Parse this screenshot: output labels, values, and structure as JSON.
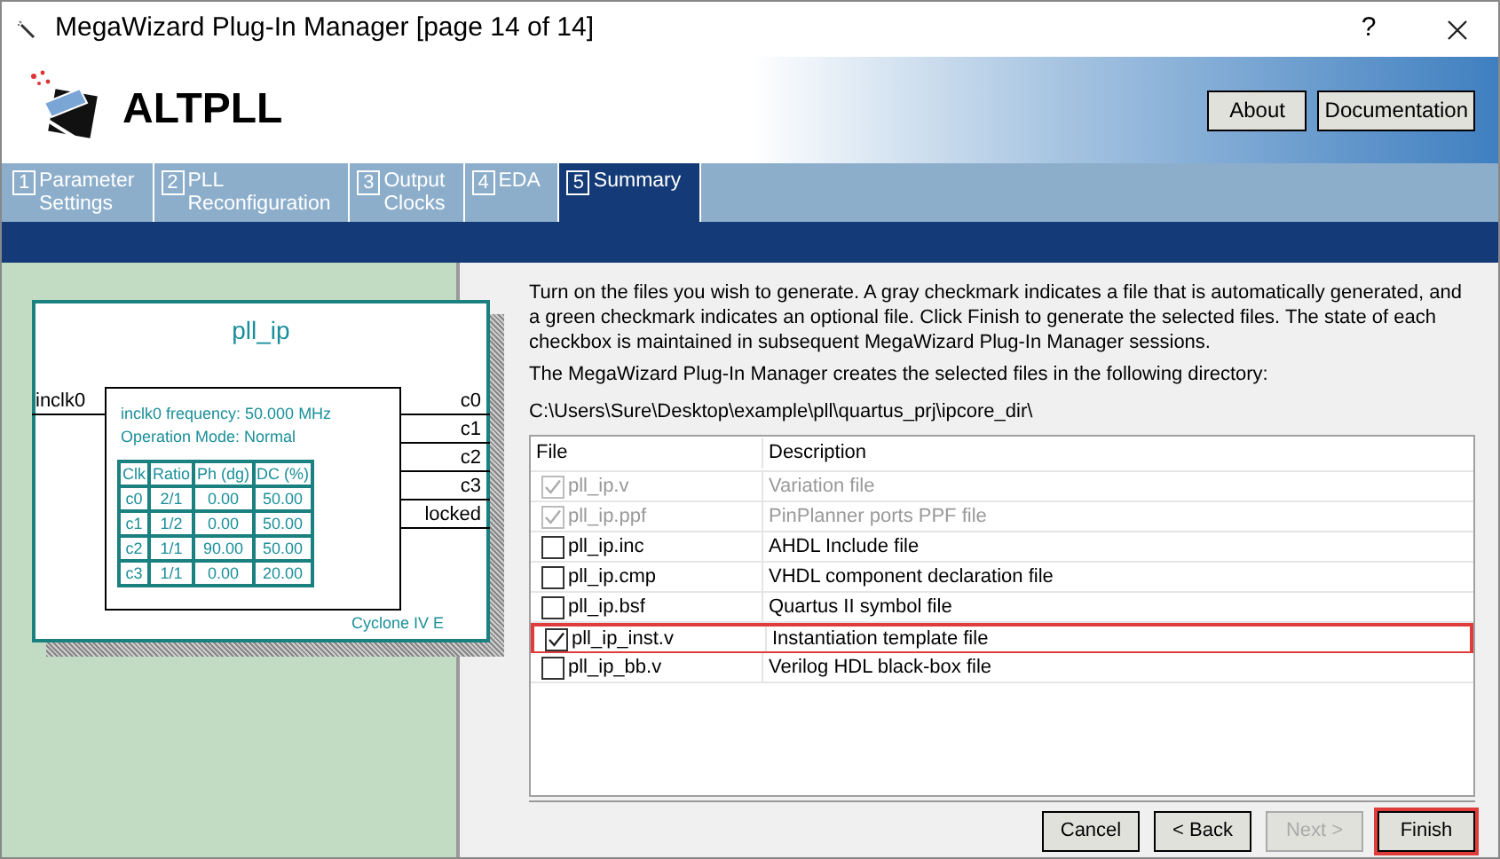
{
  "window": {
    "title": "MegaWizard Plug-In Manager [page 14 of 14]",
    "help": "?"
  },
  "header": {
    "title": "ALTPLL",
    "buttons": [
      "About",
      "Documentation"
    ]
  },
  "tabs": [
    {
      "number": "1",
      "label": "Parameter Settings",
      "selected": false
    },
    {
      "number": "2",
      "label": "PLL Reconfiguration",
      "selected": false
    },
    {
      "number": "3",
      "label": "Output Clocks",
      "selected": false
    },
    {
      "number": "4",
      "label": "EDA",
      "selected": false
    },
    {
      "number": "5",
      "label": "Summary",
      "selected": true
    }
  ],
  "symbol": {
    "name": "pll_ip",
    "input": "inclk0",
    "outputs": [
      "c0",
      "c1",
      "c2",
      "c3",
      "locked"
    ],
    "info": [
      "inclk0 frequency: 50.000 MHz",
      "Operation Mode: Normal"
    ],
    "device": "Cyclone IV E",
    "table": {
      "columns": [
        "Clk",
        "Ratio",
        "Ph (dg)",
        "DC (%)"
      ],
      "rows": [
        [
          "c0",
          "2/1",
          "0.00",
          "50.00"
        ],
        [
          "c1",
          "1/2",
          "0.00",
          "50.00"
        ],
        [
          "c2",
          "1/1",
          "90.00",
          "50.00"
        ],
        [
          "c3",
          "1/1",
          "0.00",
          "20.00"
        ]
      ]
    }
  },
  "intro": "Turn on the files you wish to generate. A gray checkmark indicates a file that is automatically generated, and a green checkmark indicates an optional file. Click Finish to generate the selected files. The state of each checkbox is maintained in subsequent MegaWizard Plug-In Manager sessions.",
  "directory_label": "The MegaWizard Plug-In Manager creates the selected files in the following directory:",
  "directory": "C:\\Users\\Sure\\Desktop\\example\\pll\\quartus_prj\\ipcore_dir\\",
  "files": {
    "columns": [
      "File",
      "Description"
    ],
    "rows": [
      {
        "file": "pll_ip.v",
        "description": "Variation file",
        "checked": true,
        "disabled": true,
        "highlighted": false
      },
      {
        "file": "pll_ip.ppf",
        "description": "PinPlanner ports PPF file",
        "checked": true,
        "disabled": true,
        "highlighted": false
      },
      {
        "file": "pll_ip.inc",
        "description": "AHDL Include file",
        "checked": false,
        "disabled": false,
        "highlighted": false
      },
      {
        "file": "pll_ip.cmp",
        "description": "VHDL component declaration file",
        "checked": false,
        "disabled": false,
        "highlighted": false
      },
      {
        "file": "pll_ip.bsf",
        "description": "Quartus II symbol file",
        "checked": false,
        "disabled": false,
        "highlighted": false
      },
      {
        "file": "pll_ip_inst.v",
        "description": "Instantiation template file",
        "checked": true,
        "disabled": false,
        "highlighted": true
      },
      {
        "file": "pll_ip_bb.v",
        "description": "Verilog HDL black-box file",
        "checked": false,
        "disabled": false,
        "highlighted": false
      }
    ]
  },
  "footer_buttons": [
    {
      "label": "Cancel",
      "disabled": false,
      "highlighted": false
    },
    {
      "label": "< Back",
      "disabled": false,
      "highlighted": false
    },
    {
      "label": "Next >",
      "disabled": true,
      "highlighted": false
    },
    {
      "label": "Finish",
      "disabled": false,
      "highlighted": true
    }
  ]
}
